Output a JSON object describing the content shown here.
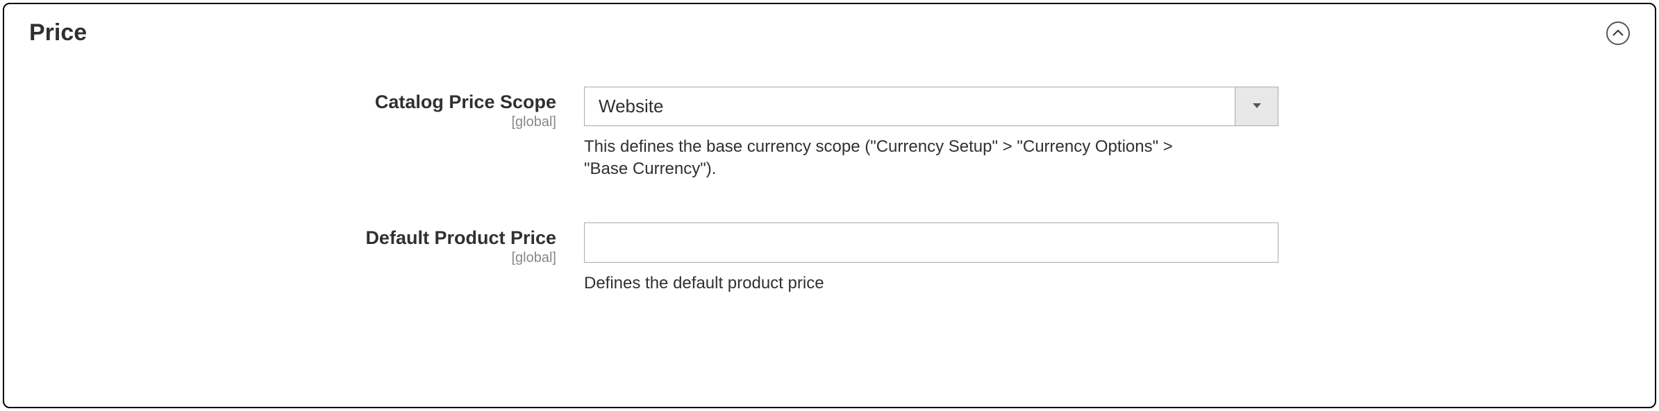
{
  "panel": {
    "title": "Price"
  },
  "fields": {
    "catalog_price_scope": {
      "label": "Catalog Price Scope",
      "scope": "[global]",
      "value": "Website",
      "help": "This defines the base currency scope (\"Currency Setup\" > \"Currency Options\" > \"Base Currency\")."
    },
    "default_product_price": {
      "label": "Default Product Price",
      "scope": "[global]",
      "value": "",
      "help": "Defines the default product price"
    }
  }
}
